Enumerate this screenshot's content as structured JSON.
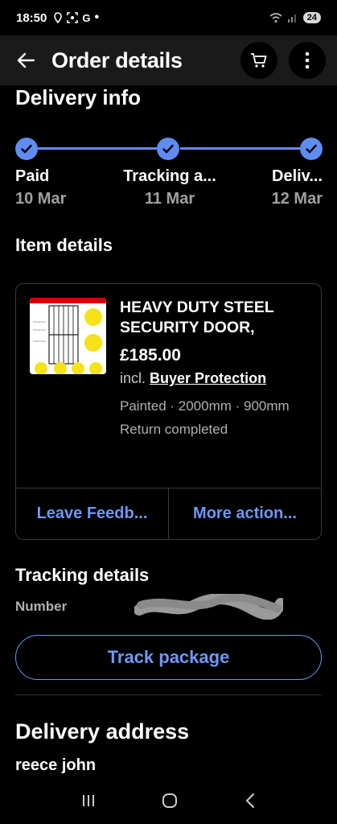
{
  "status_bar": {
    "time": "18:50",
    "left_icons": [
      "location-pin-icon",
      "screenshot-icon",
      "google-icon",
      "dot-icon"
    ],
    "google_letter": "G",
    "battery": "24"
  },
  "app_bar": {
    "title": "Order details",
    "icons": [
      "back-arrow-icon",
      "cart-icon",
      "more-vertical-icon"
    ]
  },
  "delivery_info": {
    "title": "Delivery info",
    "steps": [
      {
        "label": "Paid",
        "date": "10 Mar",
        "done": true
      },
      {
        "label": "Tracking a...",
        "date": "11 Mar",
        "done": true
      },
      {
        "label": "Deliv...",
        "date": "12 Mar",
        "done": true
      }
    ],
    "accent_color": "#5f8cf0"
  },
  "item_details": {
    "title": "Item details",
    "item_title": "HEAVY DUTY STEEL SECURITY DOOR,",
    "price": "£185.00",
    "incl_prefix": "incl.",
    "buyer_protection": "Buyer Protection",
    "variant": "Painted · 2000mm · 900mm",
    "status": "Return completed",
    "actions": [
      "Leave Feedb...",
      "More action..."
    ]
  },
  "tracking": {
    "title": "Tracking details",
    "number_label": "Number",
    "number_value": "",
    "button": "Track package"
  },
  "delivery_address": {
    "title": "Delivery address",
    "name": "reece john"
  },
  "nav_bar": {
    "icons": [
      "recent-apps-icon",
      "home-icon",
      "back-icon"
    ]
  }
}
